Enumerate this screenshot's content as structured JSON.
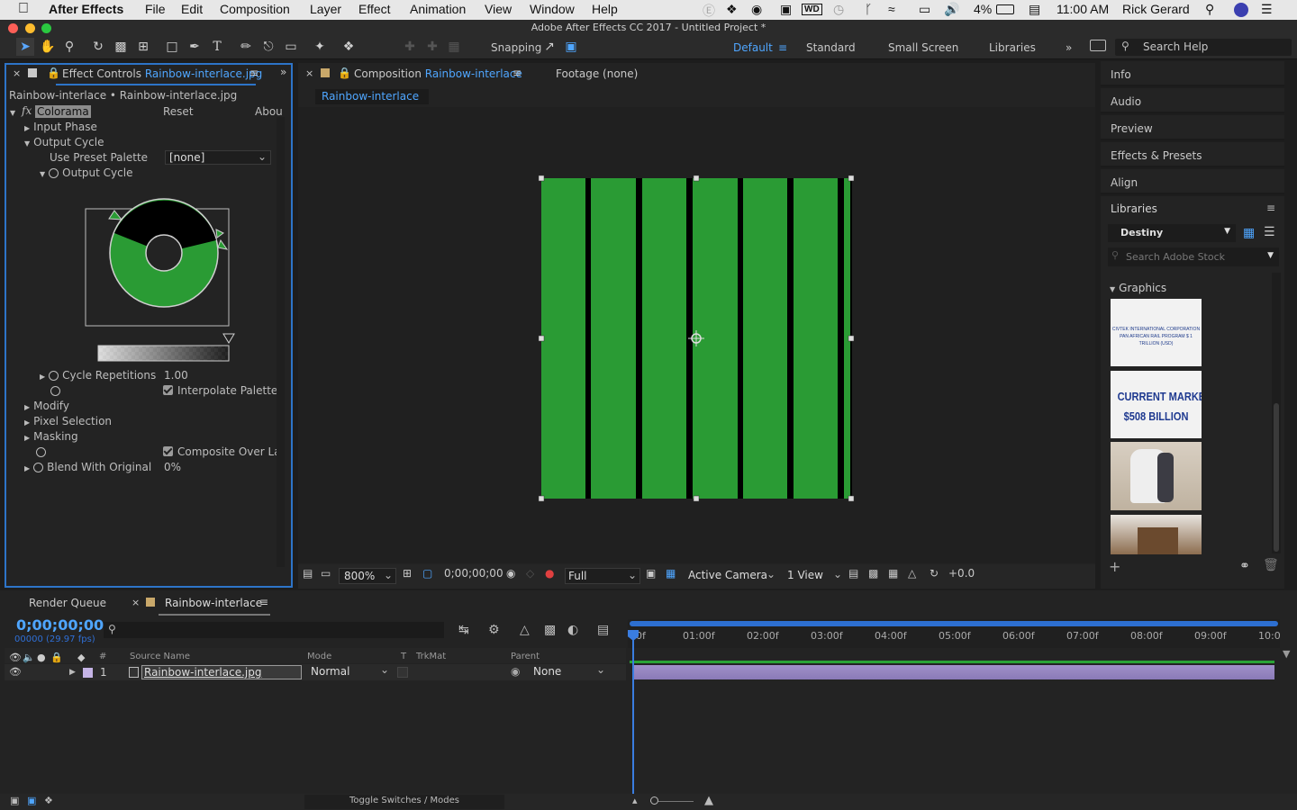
{
  "menubar": {
    "app": "After Effects",
    "items": [
      "File",
      "Edit",
      "Composition",
      "Layer",
      "Effect",
      "Animation",
      "View",
      "Window",
      "Help"
    ],
    "battery": "4%",
    "time": "11:00 AM",
    "user": "Rick Gerard"
  },
  "window_title": "Adobe After Effects CC 2017 - Untitled Project *",
  "toolbar": {
    "snapping_label": "Snapping",
    "workspaces": [
      "Default",
      "Standard",
      "Small Screen",
      "Libraries"
    ],
    "active_workspace": "Default",
    "search_placeholder": "Search Help"
  },
  "effect_controls": {
    "tab_prefix": "Effect Controls",
    "tab_file": "Rainbow-interlace.jpg",
    "breadcrumb": "Rainbow-interlace • Rainbow-interlace.jpg",
    "effect_name": "Colorama",
    "reset": "Reset",
    "about": "Abou",
    "input_phase": "Input Phase",
    "output_cycle_group": "Output Cycle",
    "use_preset_palette": "Use Preset Palette",
    "preset_value": "[none]",
    "output_cycle": "Output Cycle",
    "cycle_repetitions": "Cycle Repetitions",
    "cycle_repetitions_value": "1.00",
    "interpolate_palette": "Interpolate Palette",
    "modify": "Modify",
    "pixel_selection": "Pixel Selection",
    "masking": "Masking",
    "composite_over": "Composite Over La",
    "blend_with_original": "Blend With Original",
    "blend_value": "0%"
  },
  "composition": {
    "tab_prefix": "Composition",
    "tab_name": "Rainbow-interlace",
    "footage_tab": "Footage (none)",
    "subtab": "Rainbow-interlace",
    "zoom": "800%",
    "timecode": "0;00;00;00",
    "resolution": "Full",
    "camera": "Active Camera",
    "views": "1 View",
    "exposure": "+0.0",
    "stripe_color": "#2a9b34"
  },
  "right_panels": {
    "items": [
      "Info",
      "Audio",
      "Preview",
      "Effects & Presets",
      "Align",
      "Libraries"
    ],
    "library_name": "Destiny",
    "stock_search": "Search Adobe Stock",
    "graphics_label": "Graphics",
    "thumb1_text": "CIVTEK INTERNATIONAL CORPORATION PAN AFRICAN RAIL PROGRAM $ 1 TRILLION (USD)",
    "thumb2_line1": "CURRENT MARKET",
    "thumb2_line2": "$508 BILLION"
  },
  "timeline": {
    "render_queue": "Render Queue",
    "comp_tab": "Rainbow-interlace",
    "timecode": "0;00;00;00",
    "frames": "00000 (29.97 fps)",
    "headers": {
      "source": "Source Name",
      "mode": "Mode",
      "t": "T",
      "trkmat": "TrkMat",
      "parent": "Parent"
    },
    "layer": {
      "index": "1",
      "name": "Rainbow-interlace.jpg",
      "mode": "Normal",
      "parent": "None"
    },
    "ruler": [
      "0f",
      "01:00f",
      "02:00f",
      "03:00f",
      "04:00f",
      "05:00f",
      "06:00f",
      "07:00f",
      "08:00f",
      "09:00f",
      "10:0"
    ],
    "toggle_label": "Toggle Switches / Modes"
  }
}
